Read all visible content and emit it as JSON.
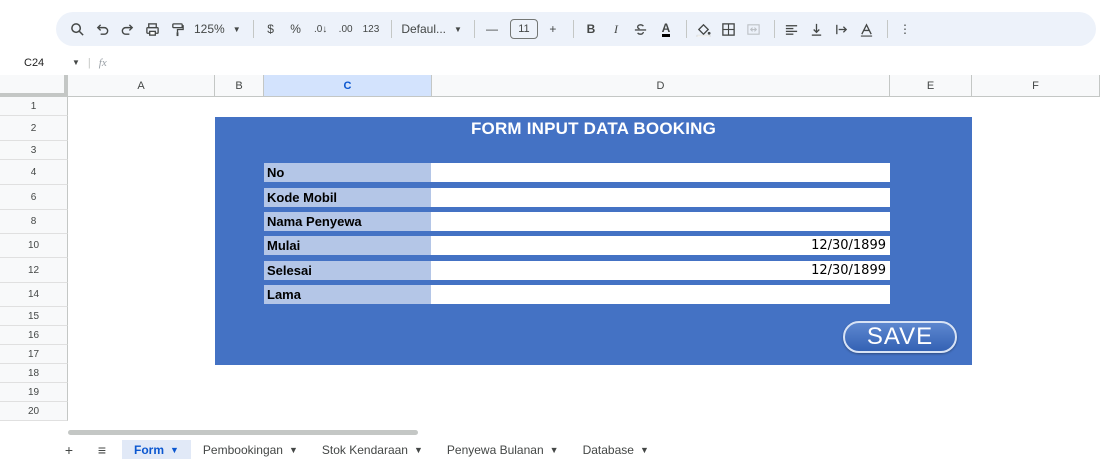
{
  "toolbar": {
    "zoom": "125%",
    "currency": "$",
    "percent": "%",
    "dec_decrease": ".0↓",
    "dec_increase": ".00",
    "number_format": "123",
    "font": "Defaul...",
    "font_size": "11",
    "minus": "—",
    "plus": "+",
    "bold": "B",
    "italic": "I",
    "text_color": "A",
    "more": "⋮"
  },
  "formula_bar": {
    "cell_ref": "C24",
    "fx": "fx"
  },
  "columns": [
    "A",
    "B",
    "C",
    "D",
    "E",
    "F"
  ],
  "rows": [
    "1",
    "2",
    "3",
    "4",
    "6",
    "8",
    "10",
    "12",
    "14",
    "15",
    "16",
    "17",
    "18",
    "19",
    "20"
  ],
  "form": {
    "title": "FORM INPUT DATA BOOKING",
    "fields": [
      {
        "label": "No",
        "value": ""
      },
      {
        "label": "Kode Mobil",
        "value": ""
      },
      {
        "label": "Nama Penyewa",
        "value": ""
      },
      {
        "label": "Mulai",
        "value": "12/30/1899"
      },
      {
        "label": "Selesai",
        "value": "12/30/1899"
      },
      {
        "label": "Lama",
        "value": ""
      }
    ],
    "save_label": "SAVE"
  },
  "sheets": {
    "add": "+",
    "all": "≡",
    "tabs": [
      {
        "label": "Form",
        "active": true
      },
      {
        "label": "Pembookingan",
        "active": false
      },
      {
        "label": "Stok Kendaraan",
        "active": false
      },
      {
        "label": "Penyewa Bulanan",
        "active": false
      },
      {
        "label": "Database",
        "active": false
      }
    ]
  },
  "colors": {
    "form_bg": "#4472c4",
    "label_bg": "#b4c6e7",
    "accent": "#0b57d0"
  }
}
